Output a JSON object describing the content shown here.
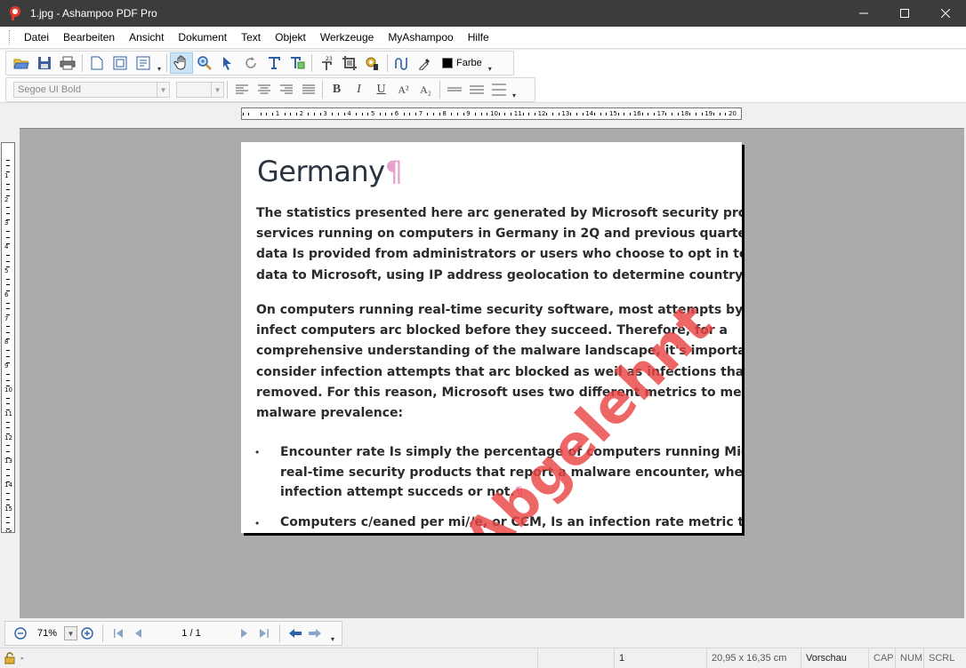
{
  "window": {
    "title": "1.jpg - Ashampoo PDF Pro",
    "minimize_label": "—",
    "maximize_label": "☐",
    "close_label": "✕"
  },
  "menu": [
    "Datei",
    "Bearbeiten",
    "Ansicht",
    "Dokument",
    "Text",
    "Objekt",
    "Werkzeuge",
    "MyAshampoo",
    "Hilfe"
  ],
  "toolbar": {
    "color_label": "Farbe",
    "color_value": "#000000"
  },
  "format_bar": {
    "font_name": "Segoe UI Bold",
    "font_size": "",
    "bold": "B",
    "italic": "I",
    "underline": "U",
    "superscript": "A²",
    "subscript": "A₂"
  },
  "ruler": {
    "horizontal_numbers": [
      "1",
      "2",
      "3",
      "4",
      "5",
      "6",
      "7",
      "8",
      "9",
      "10",
      "11",
      "12",
      "13",
      "14",
      "15",
      "16",
      "17",
      "18",
      "19",
      "20"
    ],
    "vertical_numbers": [
      "1",
      "2",
      "3",
      "4",
      "5",
      "6",
      "7",
      "8",
      "9",
      "10",
      "11",
      "12",
      "13",
      "14",
      "15",
      "16"
    ]
  },
  "document": {
    "title": "Germany",
    "pilcrow": "¶",
    "paragraph1": [
      "The statistics presented here arc generated by Microsoft security programs an",
      "services running on computers in Germany in 2Q and previous quarters. This",
      "data Is provided from administrators or users who choose to opt in to provid",
      "data to Microsoft, using IP address geolocation to determine country or regio"
    ],
    "paragraph2": [
      "On computers running real-time security software, most attempts by malwar",
      "infect computers arc blocked before they succeed. Therefore, for a",
      "comprehensive understanding of the malware landscape, it's important to",
      "consider infection attempts that arc blocked as weil as infections that arc",
      "removed. For this reason, Microsoft uses two different metrics to measure",
      "malware prevalence:"
    ],
    "bullet1": [
      "Encounter rate Is simply the percentage of computers running Microsoft",
      "real-time security products that report a malware encounter, whether the",
      "infection attempt succeds or not."
    ],
    "bullet2": [
      "Computers c/eaned per mi//e, or CCM, Is an infection rate metric that Is"
    ],
    "bullet_symbol": "•",
    "stamp": "Abgelehnt"
  },
  "navigation": {
    "zoom": "71%",
    "page_indicator": "1 / 1"
  },
  "status": {
    "lock_text": "-",
    "page_number": "1",
    "dimensions": "20,95 x 16,35 cm",
    "mode": "Vorschau",
    "cap": "CAP",
    "num": "NUM",
    "scrl": "SCRL"
  }
}
